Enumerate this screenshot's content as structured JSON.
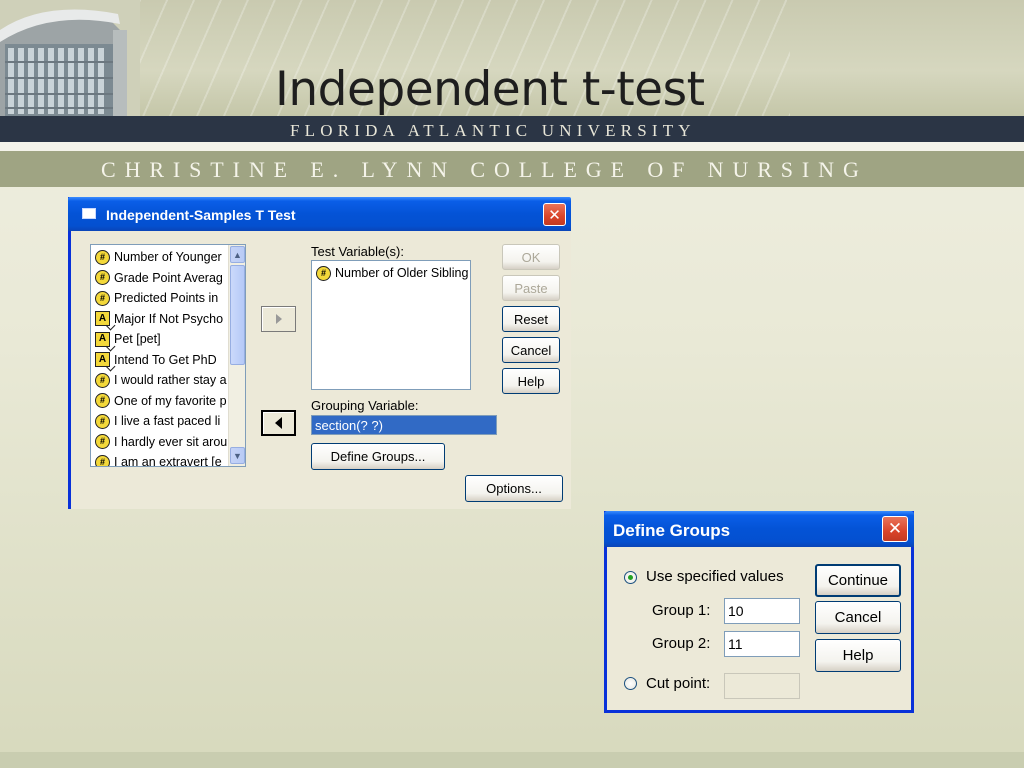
{
  "slide": {
    "title": "Independent t-test",
    "university": "FLORIDA ATLANTIC UNIVERSITY",
    "college": "CHRISTINE E. LYNN COLLEGE OF NURSING"
  },
  "ttest_dialog": {
    "title": "Independent-Samples T Test",
    "close_icon": "close-icon",
    "source_list": [
      {
        "label": "Number of Younger",
        "icon": "scale"
      },
      {
        "label": "Grade Point Averag",
        "icon": "scale"
      },
      {
        "label": "Predicted Points in",
        "icon": "scale"
      },
      {
        "label": "Major If Not Psycho",
        "icon": "nominal"
      },
      {
        "label": "Pet [pet]",
        "icon": "nominal"
      },
      {
        "label": "Intend To Get PhD",
        "icon": "nominal"
      },
      {
        "label": "I would rather stay a",
        "icon": "scale"
      },
      {
        "label": "One of my favorite p",
        "icon": "scale"
      },
      {
        "label": "I live a fast paced li",
        "icon": "scale"
      },
      {
        "label": "I hardly ever sit arou",
        "icon": "scale"
      },
      {
        "label": "I am an extravert [e",
        "icon": "scale"
      }
    ],
    "test_variables_label": "Test Variable(s):",
    "test_variables": [
      "Number of Older Sibling"
    ],
    "grouping_variable_label": "Grouping Variable:",
    "grouping_variable_value": "section(? ?)",
    "define_groups_button": "Define Groups...",
    "options_button": "Options...",
    "buttons": {
      "ok": "OK",
      "paste": "Paste",
      "reset": "Reset",
      "cancel": "Cancel",
      "help": "Help"
    }
  },
  "define_groups_dialog": {
    "title": "Define Groups",
    "use_specified_values_label": "Use specified values",
    "use_specified_values_selected": true,
    "group1_label": "Group 1:",
    "group1_value": "10",
    "group2_label": "Group 2:",
    "group2_value": "11",
    "cut_point_label": "Cut point:",
    "cut_point_value": "",
    "buttons": {
      "continue": "Continue",
      "cancel": "Cancel",
      "help": "Help"
    }
  }
}
